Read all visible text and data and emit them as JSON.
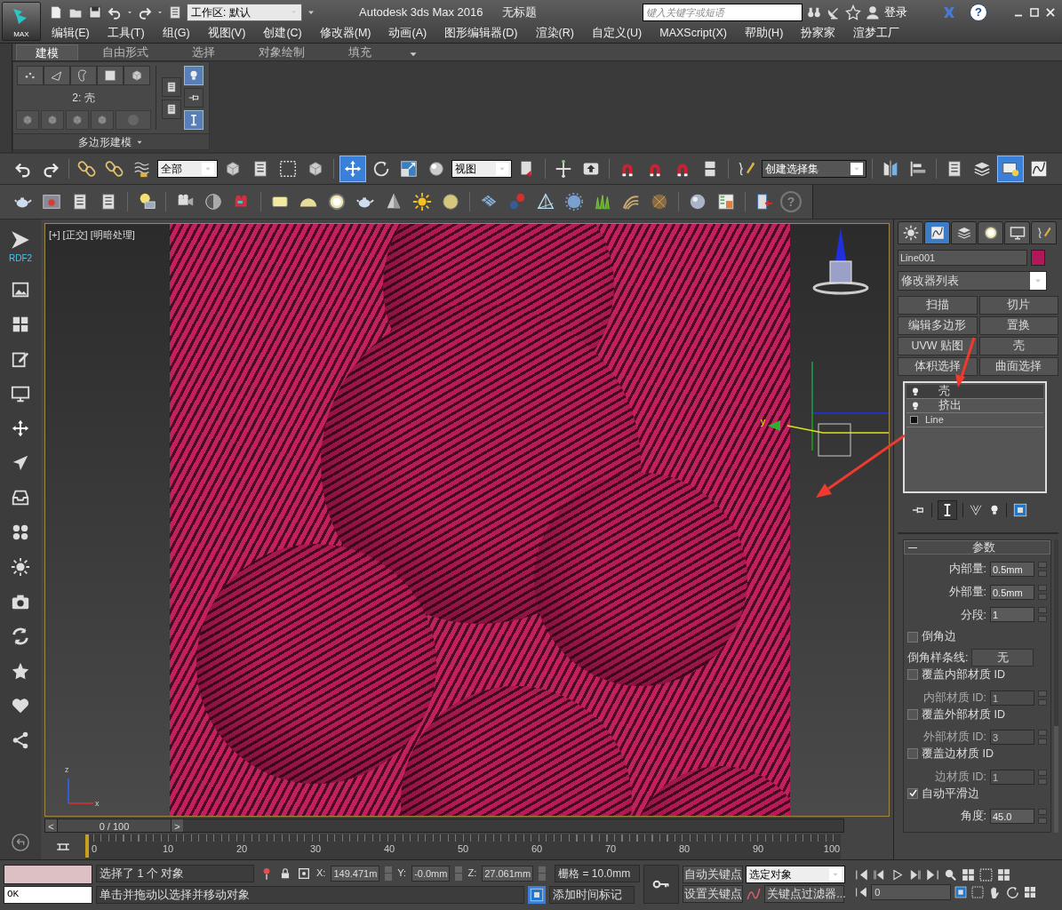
{
  "title_bar": {
    "app_button": "MAX",
    "workspace": "工作区: 默认",
    "title": "Autodesk 3ds Max 2016",
    "document": "无标题",
    "search": {
      "placeholder": "键入关键字或短语"
    },
    "sign_in": "登录",
    "help": "?"
  },
  "menu": [
    "编辑(E)",
    "工具(T)",
    "组(G)",
    "视图(V)",
    "创建(C)",
    "修改器(M)",
    "动画(A)",
    "图形编辑器(D)",
    "渲染(R)",
    "自定义(U)",
    "MAXScript(X)",
    "帮助(H)",
    "扮家家",
    "渲梦工厂"
  ],
  "ribbon": {
    "tabs": [
      {
        "label": "建模",
        "selected": true
      },
      {
        "label": "自由形式",
        "selected": false
      },
      {
        "label": "选择",
        "selected": false
      },
      {
        "label": "对象绘制",
        "selected": false
      },
      {
        "label": "填充",
        "selected": false
      }
    ],
    "level_label": "2: 壳",
    "panel_title": "多边形建模",
    "side_buttons": [
      {
        "on": false
      },
      {
        "on": false
      },
      {
        "on": true
      },
      {
        "on": false
      },
      {
        "on": true
      }
    ]
  },
  "main_toolbar": {
    "selection_filter": "全部",
    "reference_coord": "视图",
    "selection_set": "创建选择集",
    "move_active": true,
    "scene_explorer_active": true
  },
  "tools_toolbar": {
    "help": "?"
  },
  "left_sidebar": {
    "label": "RDF2"
  },
  "viewport": {
    "labels": [
      "[+]",
      "[正交]",
      "[明暗处理]"
    ],
    "gizmo_axis": "y",
    "tripod_axes": [
      "z",
      "x"
    ]
  },
  "command_panel": {
    "tabs": [
      {
        "selected": false
      },
      {
        "selected": true
      },
      {
        "selected": false
      },
      {
        "selected": false
      },
      {
        "selected": false
      },
      {
        "selected": false
      }
    ],
    "object_name": "Line001",
    "modifier_list": "修改器列表",
    "modifier_buttons": [
      "扫描",
      "切片",
      "编辑多边形",
      "置换",
      "UVW 贴图",
      "壳",
      "体积选择",
      "曲面选择"
    ],
    "stack": [
      {
        "label": "壳",
        "kind": "modifier",
        "selected": true
      },
      {
        "label": "挤出",
        "kind": "modifier",
        "selected": false
      },
      {
        "label": "Line",
        "kind": "base",
        "selected": false
      }
    ],
    "rollout": "参数",
    "rows": [
      {
        "kind": "spinner",
        "label": "内部量:",
        "value": "0.5mm",
        "disabled": false
      },
      {
        "kind": "spinner",
        "label": "外部量:",
        "value": "0.5mm",
        "disabled": false
      },
      {
        "kind": "spinner",
        "label": "分段:",
        "value": "1",
        "disabled": false
      },
      {
        "kind": "checkbox",
        "label": "倒角边",
        "checked": false
      },
      {
        "kind": "picker",
        "label": "倒角样条线:",
        "value": "无"
      },
      {
        "kind": "checkbox",
        "label": "覆盖内部材质 ID",
        "checked": false
      },
      {
        "kind": "spinner",
        "label": "内部材质 ID:",
        "value": "1",
        "disabled": true
      },
      {
        "kind": "checkbox",
        "label": "覆盖外部材质 ID",
        "checked": false
      },
      {
        "kind": "spinner",
        "label": "外部材质 ID:",
        "value": "3",
        "disabled": true
      },
      {
        "kind": "checkbox",
        "label": "覆盖边材质 ID",
        "checked": false
      },
      {
        "kind": "spinner",
        "label": "边材质 ID:",
        "value": "1",
        "disabled": true
      },
      {
        "kind": "checkbox",
        "label": "自动平滑边",
        "checked": true
      },
      {
        "kind": "spinner",
        "label": "角度:",
        "value": "45.0",
        "disabled": false
      }
    ]
  },
  "timeline": {
    "frame": "0 / 100",
    "prev": "<",
    "next": ">",
    "level": 0,
    "ticks": [
      "0",
      "10",
      "20",
      "30",
      "40",
      "50",
      "60",
      "70",
      "80",
      "90",
      "100"
    ]
  },
  "status_bar": {
    "listener": "OK",
    "selection": "选择了 1 个 对象",
    "prompt": "单击并拖动以选择并移动对象",
    "coords": [
      {
        "label": "X:",
        "value": "149.471m"
      },
      {
        "label": "Y:",
        "value": "-0.0mm"
      },
      {
        "label": "Z:",
        "value": "27.061mm"
      }
    ],
    "grid": "栅格 = 10.0mm",
    "add_time_tag": "添加时间标记",
    "auto_key": "自动关键点",
    "set_key": "设置关键点",
    "key_target": "选定对象",
    "key_filters": "关键点过滤器...",
    "frame_field": "0"
  }
}
